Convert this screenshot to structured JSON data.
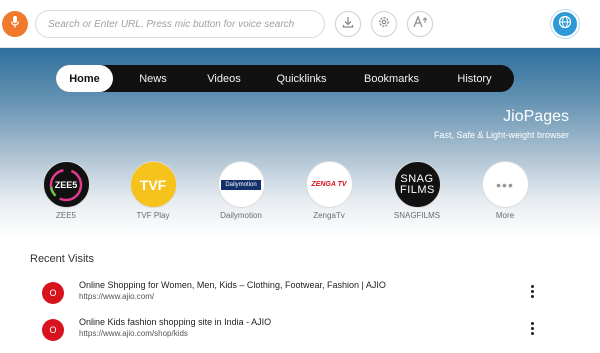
{
  "toolbar": {
    "search_placeholder": "Search or Enter URL. Press mic button for voice search"
  },
  "nav": {
    "tabs": [
      {
        "label": "Home",
        "active": true
      },
      {
        "label": "News",
        "active": false
      },
      {
        "label": "Videos",
        "active": false
      },
      {
        "label": "Quicklinks",
        "active": false
      },
      {
        "label": "Bookmarks",
        "active": false
      },
      {
        "label": "History",
        "active": false
      }
    ]
  },
  "brand": {
    "title": "JioPages",
    "subtitle": "Fast, Safe & Light-weight browser"
  },
  "shortcuts": [
    {
      "label": "ZEE5",
      "logo_text": "ZEE5"
    },
    {
      "label": "TVF Play",
      "logo_text": "TVF"
    },
    {
      "label": "Dailymotion",
      "logo_text": "Dailymotion"
    },
    {
      "label": "ZengaTv",
      "logo_text": "ZENGA TV"
    },
    {
      "label": "SNAGFILMS",
      "logo_text": "SNAG FILMS"
    },
    {
      "label": "More",
      "logo_text": "•••"
    }
  ],
  "recent": {
    "title": "Recent Visits",
    "items": [
      {
        "favicon_letter": "O",
        "title": "Online Shopping for Women, Men, Kids – Clothing, Footwear, Fashion | AJIO",
        "url": "https://www.ajio.com/"
      },
      {
        "favicon_letter": "O",
        "title": "Online Kids fashion shopping site in India - AJIO",
        "url": "https://www.ajio.com/shop/kids"
      }
    ]
  },
  "colors": {
    "accent_orange": "#ef7a2b",
    "globe_blue": "#2e9ad5",
    "favicon_red": "#d7141e"
  },
  "icons": {
    "mic": "mic-icon",
    "download": "download-icon",
    "settings": "gear-icon",
    "text_size": "text-size-icon",
    "language": "globe-icon",
    "overflow": "kebab-icon"
  }
}
